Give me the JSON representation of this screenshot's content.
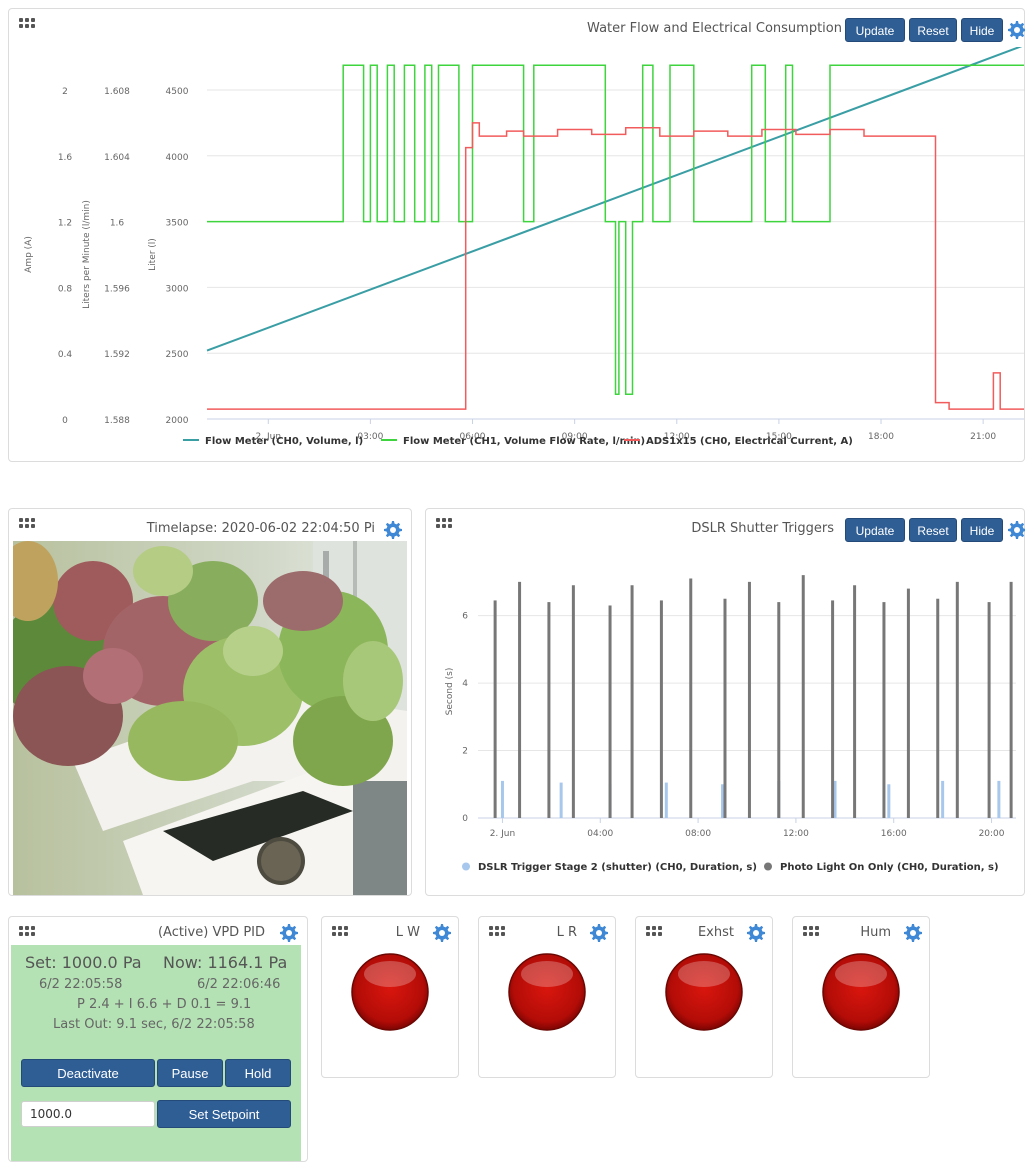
{
  "colors": {
    "button_bg": "#2f5e95",
    "gear": "#3f88d6",
    "flow_volume": "#3a9ea5",
    "flow_rate": "#3dd43d",
    "current": "#f25b5b",
    "trigger_stage": "#a7c8ec",
    "photo_light": "#777777",
    "pid_panel": "#b4e2b4",
    "lamp": "#c0100a"
  },
  "top_widget": {
    "title": "Water Flow and Electrical Consumption",
    "buttons": {
      "update": "Update",
      "reset": "Reset",
      "hide": "Hide"
    },
    "chart_data": {
      "type": "line",
      "title": "Water Flow and Electrical Consumption",
      "x_ticks": [
        "2. Jun",
        "03:00",
        "06:00",
        "09:00",
        "12:00",
        "15:00",
        "18:00",
        "21:00"
      ],
      "x_tick_hours": [
        0,
        3,
        6,
        9,
        12,
        15,
        18,
        21
      ],
      "xlim_hours": [
        -1.8,
        22.2
      ],
      "axes": [
        {
          "label": "Amp (A)",
          "ticks": [
            "0",
            "0.4",
            "0.8",
            "1.2",
            "1.6",
            "2"
          ],
          "ylim": [
            0,
            2
          ]
        },
        {
          "label": "Liters per Minute (l/min)",
          "ticks": [
            "1.588",
            "1.592",
            "1.596",
            "1.6",
            "1.604",
            "1.608"
          ],
          "ylim": [
            1.588,
            1.608
          ]
        },
        {
          "label": "Liter (l)",
          "ticks": [
            "2000",
            "2500",
            "3000",
            "3500",
            "4000",
            "4500"
          ],
          "ylim": [
            2000,
            4500
          ]
        }
      ],
      "series": [
        {
          "name": "Flow Meter (CH0, Volume, l)",
          "axis": 2,
          "x": [
            -1.8,
            22.2
          ],
          "y": [
            2520,
            4840
          ]
        },
        {
          "name": "Flow Meter (CH1, Volume Flow Rate, l/min)",
          "axis": 1,
          "x": [
            -1.8,
            2.2,
            2.2,
            2.8,
            2.8,
            3.0,
            3.0,
            3.2,
            3.2,
            3.5,
            3.5,
            3.7,
            3.7,
            4.0,
            4.0,
            4.3,
            4.3,
            4.6,
            4.6,
            4.8,
            4.8,
            5.0,
            5.0,
            5.6,
            5.6,
            6.0,
            6.0,
            7.5,
            7.5,
            7.8,
            7.8,
            9.9,
            9.9,
            10.2,
            10.2,
            10.3,
            10.3,
            10.5,
            10.5,
            10.7,
            10.7,
            11.0,
            11.0,
            11.3,
            11.3,
            11.8,
            11.8,
            12.5,
            12.5,
            14.2,
            14.2,
            14.6,
            14.6,
            15.2,
            15.2,
            15.4,
            15.4,
            16.5,
            16.5,
            22.2
          ],
          "y": [
            1.6,
            1.6,
            1.6095,
            1.6095,
            1.6,
            1.6,
            1.6095,
            1.6095,
            1.6,
            1.6,
            1.6095,
            1.6095,
            1.6,
            1.6,
            1.6095,
            1.6095,
            1.6,
            1.6,
            1.6095,
            1.6095,
            1.6,
            1.6,
            1.6095,
            1.6095,
            1.6,
            1.6,
            1.6095,
            1.6095,
            1.6,
            1.6,
            1.6095,
            1.6095,
            1.6,
            1.6,
            1.5895,
            1.5895,
            1.6,
            1.6,
            1.5895,
            1.5895,
            1.6,
            1.6,
            1.6095,
            1.6095,
            1.6,
            1.6,
            1.6095,
            1.6095,
            1.6,
            1.6,
            1.6095,
            1.6095,
            1.6,
            1.6,
            1.6095,
            1.6095,
            1.6,
            1.6,
            1.6095,
            1.6095
          ]
        },
        {
          "name": "ADS1x15 (CH0, Electrical Current, A)",
          "axis": 0,
          "x": [
            -1.8,
            5.8,
            5.8,
            6.0,
            6.0,
            6.2,
            6.2,
            7.0,
            7.0,
            7.5,
            7.5,
            8.5,
            8.5,
            9.5,
            9.5,
            10.5,
            10.5,
            11.5,
            11.5,
            12.5,
            12.5,
            13.5,
            13.5,
            14.5,
            14.5,
            15.5,
            15.5,
            16.5,
            16.5,
            17.5,
            17.5,
            18.5,
            18.5,
            19.6,
            19.6,
            20.0,
            20.0,
            21.3,
            21.3,
            21.5,
            21.5,
            22.2
          ],
          "y": [
            0.06,
            0.06,
            1.65,
            1.65,
            1.8,
            1.8,
            1.72,
            1.72,
            1.75,
            1.75,
            1.72,
            1.72,
            1.76,
            1.76,
            1.73,
            1.73,
            1.77,
            1.77,
            1.72,
            1.72,
            1.75,
            1.75,
            1.72,
            1.72,
            1.76,
            1.76,
            1.73,
            1.73,
            1.76,
            1.76,
            1.72,
            1.72,
            1.72,
            1.72,
            0.1,
            0.1,
            0.06,
            0.06,
            0.28,
            0.28,
            0.06,
            0.06
          ]
        }
      ],
      "legend": "bottom"
    }
  },
  "timelapse_widget": {
    "title": "Timelapse: 2020-06-02 22:04:50 Pi"
  },
  "dslr_widget": {
    "title": "DSLR Shutter Triggers",
    "buttons": {
      "update": "Update",
      "reset": "Reset",
      "hide": "Hide"
    },
    "chart_data": {
      "type": "bar",
      "title": "DSLR Shutter Triggers",
      "ylabel": "Second (s)",
      "ylim": [
        0,
        7.5
      ],
      "y_ticks": [
        "0",
        "2",
        "4",
        "6"
      ],
      "x_ticks": [
        "2. Jun",
        "04:00",
        "08:00",
        "12:00",
        "16:00",
        "20:00"
      ],
      "x_tick_hours": [
        0,
        4,
        8,
        12,
        16,
        20
      ],
      "xlim_hours": [
        -1,
        21
      ],
      "series": [
        {
          "name": "DSLR Trigger Stage 2 (shutter) (CH0, Duration, s)",
          "x": [
            0,
            2.4,
            4.4,
            6.7,
            9,
            11.3,
            13.6,
            15.8,
            18,
            20.3,
            22.4
          ],
          "y": [
            1.1,
            1.05,
            1.0,
            1.05,
            1.0,
            1.1,
            1.1,
            1.0,
            1.1,
            1.1,
            1.05
          ]
        },
        {
          "name": "Photo Light On Only (CH0, Duration, s)",
          "x": [
            -0.3,
            0.7,
            1.9,
            2.9,
            4.4,
            5.3,
            6.5,
            7.7,
            9.1,
            10.1,
            11.3,
            12.3,
            13.5,
            14.4,
            15.6,
            16.6,
            17.8,
            18.6,
            19.9,
            20.8
          ],
          "y": [
            6.45,
            7.0,
            6.4,
            6.9,
            6.3,
            6.9,
            6.45,
            7.1,
            6.5,
            7.0,
            6.4,
            7.2,
            6.45,
            6.9,
            6.4,
            6.8,
            6.5,
            7.0,
            6.4,
            7.0
          ]
        }
      ],
      "legend": "bottom"
    }
  },
  "pid_widget": {
    "title": "(Active) VPD PID",
    "set_line": "Set: 1000.0 Pa",
    "now_line": "Now: 1164.1 Pa",
    "set_time": "6/2 22:05:58",
    "now_time": "6/2 22:06:46",
    "pid_terms": "P 2.4 + I 6.6 + D 0.1 = 9.1",
    "last_out": "Last Out: 9.1 sec, 6/2 22:05:58",
    "buttons": {
      "deactivate": "Deactivate",
      "pause": "Pause",
      "hold": "Hold",
      "set_setpoint": "Set Setpoint"
    },
    "setpoint_value": "1000.0"
  },
  "outputs": [
    {
      "name": "L W"
    },
    {
      "name": "L R"
    },
    {
      "name": "Exhst"
    },
    {
      "name": "Hum"
    }
  ]
}
